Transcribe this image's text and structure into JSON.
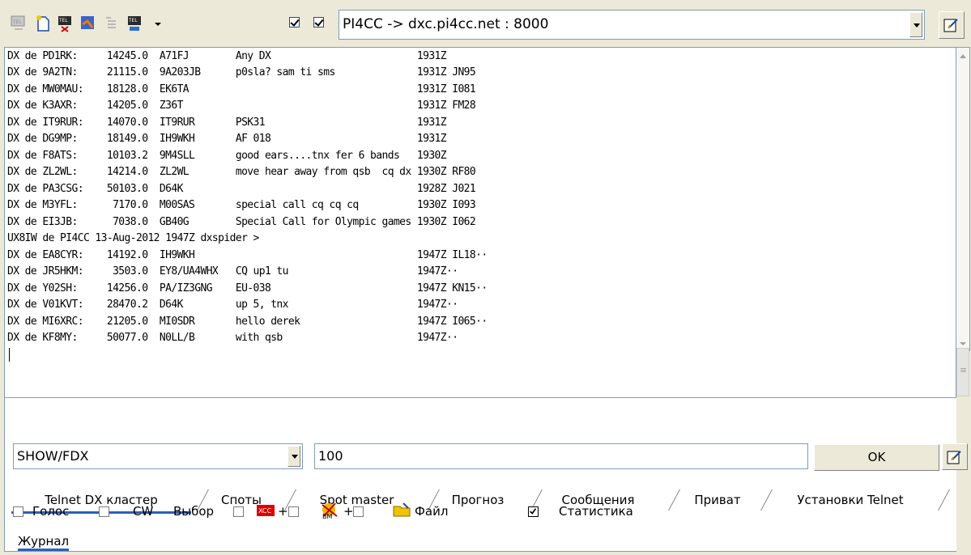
{
  "toolbar": {
    "icons": [
      "telnet-connect-icon",
      "new-document-icon",
      "telnet-disconnect-icon",
      "filter-icon",
      "list-icon",
      "telnet-settings-icon",
      "dropdown-arrow-icon"
    ],
    "check1": true,
    "check2": true,
    "server": "PI4CC -> dxc.pi4cc.net : 8000"
  },
  "terminal": {
    "lines": [
      "DX de PD1RK:     14245.0  A71FJ        Any DX                         1931Z",
      "DX de 9A2TN:     21115.0  9A203JB      p0sla? sam ti sms              1931Z JN95",
      "DX de MW0MAU:    18128.0  EK6TA                                       1931Z I081",
      "DX de K3AXR:     14205.0  Z36T                                        1931Z FM28",
      "DX de IT9RUR:    14070.0  IT9RUR       PSK31                          1931Z",
      "DX de DG9MP:     18149.0  IH9WKH       AF 018                         1931Z",
      "DX de F8ATS:     10103.2  9M4SLL       good ears....tnx fer 6 bands   1930Z",
      "DX de ZL2WL:     14214.0  ZL2WL        move hear away from qsb  cq dx 1930Z RF80",
      "DX de PA3CSG:    50103.0  D64K                                        1928Z J021",
      "DX de M3YFL:      7170.0  M00SAS       special call cq cq cq          1930Z I093",
      "DX de EI3JB:      7038.0  GB40G        Special Call for Olympic games 1930Z I062",
      "UX8IW de PI4CC 13-Aug-2012 1947Z dxspider >",
      "DX de EA8CYR:    14192.0  IH9WKH                                      1947Z IL18··",
      "DX de JR5HKM:     3503.0  EY8/UA4WHX   CQ up1 tu                      1947Z··",
      "DX de Y02SH:     14256.0  PA/IZ3GNG    EU-038                         1947Z KN15··",
      "DX de V01KVT:    28470.2  D64K         up 5, tnx                      1947Z··",
      "DX de MI6XRC:    21205.0  MI0SDR       hello derek                    1947Z I065··",
      "DX de KF8MY:     50077.0  N0LL/B       with qsb                       1947Z··"
    ]
  },
  "command": {
    "value": "SHOW/FDX",
    "count": "100",
    "ok_label": "OK"
  },
  "tabs": [
    {
      "label": "Telnet DX кластер",
      "active": true
    },
    {
      "label": "Споты",
      "active": false
    },
    {
      "label": "Spot master",
      "active": false
    },
    {
      "label": "Прогноз",
      "active": false
    },
    {
      "label": "Сообщения",
      "active": false
    },
    {
      "label": "Приват",
      "active": false
    },
    {
      "label": "Установки Telnet",
      "active": false
    }
  ],
  "options": {
    "voice": "Голос",
    "cw": "CW",
    "select": "Выбор",
    "plus1": "+",
    "plus2": "+",
    "file": "Файл",
    "stats": "Статистика",
    "stats_checked": true
  },
  "bottom_tab": "Журнал",
  "colors": {
    "background": "#ece9d8",
    "border": "#7f9db9",
    "accent_tab": "#2b61b8"
  }
}
